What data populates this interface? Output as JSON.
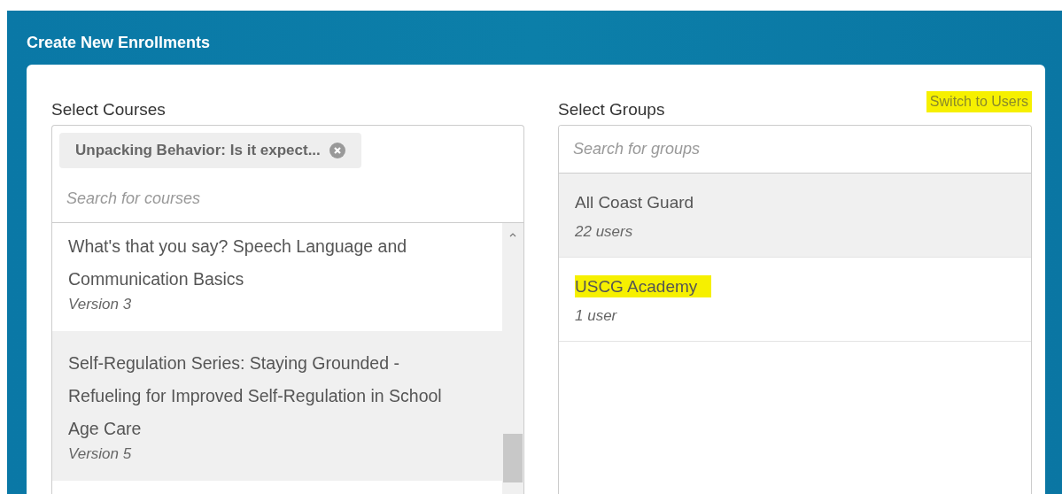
{
  "window": {
    "title": "Create New Enrollments"
  },
  "courses": {
    "label": "Select Courses",
    "chips": [
      {
        "label": "Unpacking Behavior: Is it expect..."
      }
    ],
    "search": {
      "placeholder": "Search for courses"
    },
    "items": [
      {
        "title": "What's that you say? Speech Language and Communication Basics",
        "version": "Version 3",
        "hovered": false
      },
      {
        "title": "Self-Regulation Series: Staying Grounded - Refueling for Improved Self-Regulation in School Age Care",
        "version": "Version 5",
        "hovered": true
      }
    ]
  },
  "groups": {
    "label": "Select Groups",
    "switch_link": {
      "label": "Switch to Users",
      "highlighted": true
    },
    "search": {
      "placeholder": "Search for groups"
    },
    "items": [
      {
        "name": "All Coast Guard",
        "count": "22 users",
        "hovered": true,
        "highlighted": false
      },
      {
        "name": "USCG Academy",
        "count": "1 user",
        "hovered": false,
        "highlighted": true
      }
    ]
  }
}
